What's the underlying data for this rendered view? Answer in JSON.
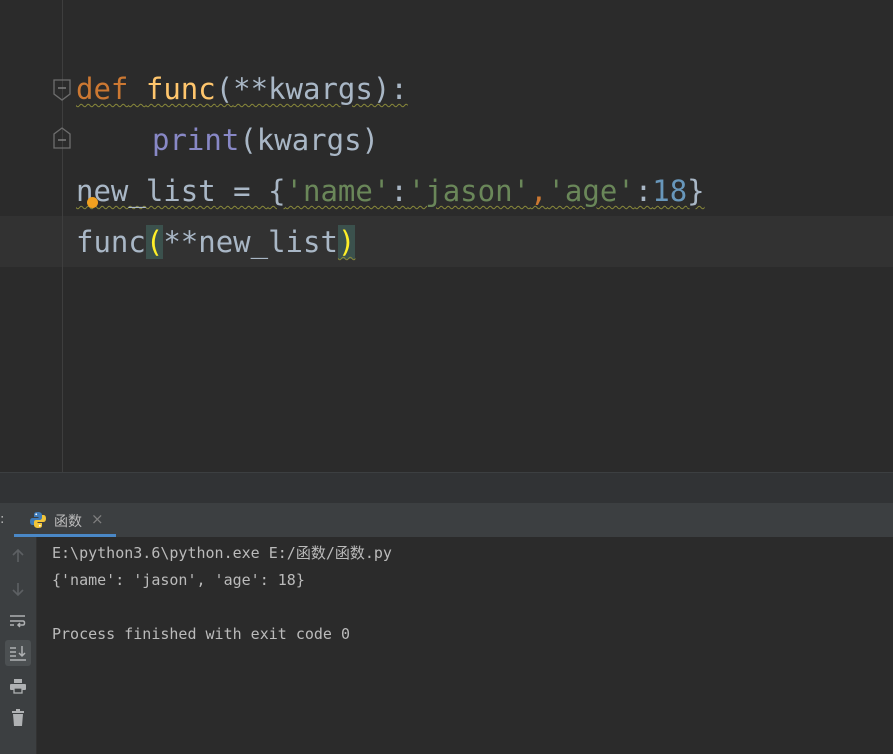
{
  "editor": {
    "line1": {
      "kw": "def",
      "name": "func",
      "open": "(",
      "args": "**kwargs",
      "close": "):"
    },
    "line2": {
      "builtin": "print",
      "open": "(",
      "args": "kwargs",
      "close": ")"
    },
    "line3": {
      "var": "new_list",
      "eq": " = ",
      "lbrace": "{",
      "k1": "'name'",
      "c1": ":",
      "v1": "'jason'",
      "comma": ",",
      "k2": "'age'",
      "c2": ":",
      "v2": "18",
      "rbrace": "}"
    },
    "line4": {
      "name": "func",
      "open": "(",
      "args": "**new_list",
      "close": ")"
    }
  },
  "run_panel": {
    "prefix": ":",
    "tab_label": "函数",
    "tab_close": "×",
    "output": [
      "E:\\python3.6\\python.exe E:/函数/函数.py",
      "{'name': 'jason', 'age': 18}",
      "",
      "Process finished with exit code 0"
    ],
    "toolbar_icons": [
      "arrow-up-icon",
      "arrow-down-icon",
      "soft-wrap-icon",
      "scroll-to-end-icon",
      "print-icon",
      "trash-icon"
    ]
  },
  "colors": {
    "background": "#2b2b2b",
    "keyword": "#cc7832",
    "function": "#ffc66d",
    "builtin": "#8888c6",
    "string": "#6a8759",
    "number": "#6897bb",
    "bracket_highlight": "#ffef28",
    "tab_underline": "#4a88c7"
  }
}
